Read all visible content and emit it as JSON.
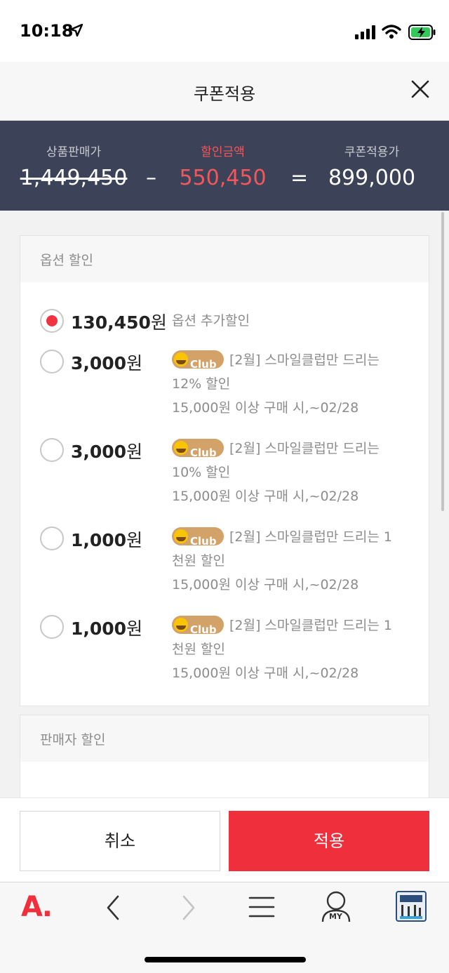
{
  "status_bar": {
    "time": "10:18"
  },
  "header": {
    "title": "쿠폰적용"
  },
  "summary": {
    "original_label": "상품판매가",
    "original_value": "1,449,450",
    "discount_label": "할인금액",
    "discount_value": "550,450",
    "final_label": "쿠폰적용가",
    "final_value": "899,000",
    "minus_sign": "–",
    "equals_sign": "="
  },
  "option_section": {
    "title": "옵션 할인",
    "options": [
      {
        "amount": "130,450",
        "unit": "원",
        "selected": true,
        "desc": "옵션 추가할인",
        "club": false
      },
      {
        "amount": "3,000",
        "unit": "원",
        "selected": false,
        "club": true,
        "desc": "[2월] 스마일클럽만 드리는 12% 할인",
        "condition": "15,000원 이상 구매 시,~02/28"
      },
      {
        "amount": "3,000",
        "unit": "원",
        "selected": false,
        "club": true,
        "desc": "[2월] 스마일클럽만 드리는 10% 할인",
        "condition": "15,000원 이상 구매 시,~02/28"
      },
      {
        "amount": "1,000",
        "unit": "원",
        "selected": false,
        "club": true,
        "desc": "[2월] 스마일클럽만 드리는 1천원 할인",
        "condition": "15,000원 이상 구매 시,~02/28"
      },
      {
        "amount": "1,000",
        "unit": "원",
        "selected": false,
        "club": true,
        "desc": "[2월] 스마일클럽만 드리는 1천원 할인",
        "condition": "15,000원 이상 구매 시,~02/28"
      }
    ],
    "club_badge": "Club"
  },
  "seller_section": {
    "title": "판매자 할인"
  },
  "actions": {
    "cancel": "취소",
    "apply": "적용"
  },
  "toolbar": {
    "logo": "A.",
    "my_label": "MY"
  },
  "colors": {
    "accent": "#ef2f3b",
    "summary_bg": "#3c4257",
    "discount": "#f0585d",
    "club_badge": "#d2a268"
  }
}
